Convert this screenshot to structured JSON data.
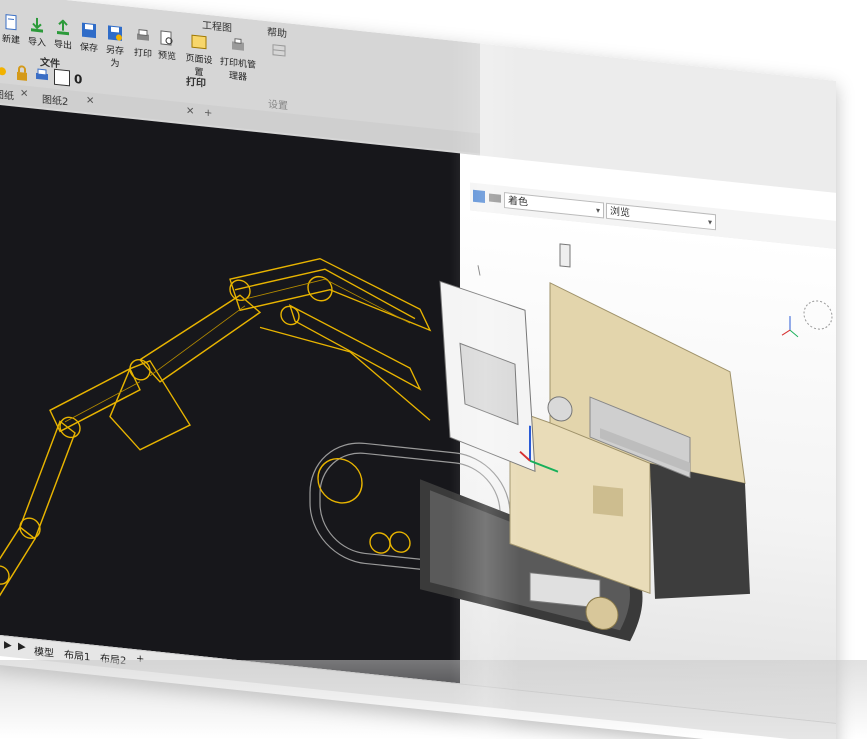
{
  "ribbon": {
    "tabs": [
      "工程图",
      "帮助"
    ],
    "file_tools": [
      {
        "label": "新建",
        "icon": "new-file-icon"
      },
      {
        "label": "导入",
        "icon": "import-icon"
      },
      {
        "label": "导出",
        "icon": "export-icon"
      },
      {
        "label": "保存",
        "icon": "save-icon"
      },
      {
        "label": "另存为",
        "icon": "save-as-icon"
      }
    ],
    "print_tools": [
      {
        "label": "打印",
        "icon": "print-icon"
      },
      {
        "label": "预览",
        "icon": "preview-icon"
      },
      {
        "label": "页面设置",
        "icon": "page-setup-icon"
      },
      {
        "label": "打印机管理器",
        "icon": "printer-manager-icon"
      }
    ],
    "group_labels": {
      "file": "文件",
      "print": "打印",
      "settings": "设置"
    },
    "quick_value": "0"
  },
  "doc_tabs": [
    "图纸",
    "图纸2"
  ],
  "view_toolbar": {
    "shading_combo": "着色",
    "view_combo": "浏览"
  },
  "status_bar": {
    "model_tab": "模型",
    "layout1": "布局1",
    "layout2": "布局2",
    "add": "+"
  },
  "colors": {
    "wireframe": "#e8b400",
    "dark_bg": "#17171b",
    "body_beige": "#e9dcb8",
    "track_dark": "#3a3a3a"
  }
}
